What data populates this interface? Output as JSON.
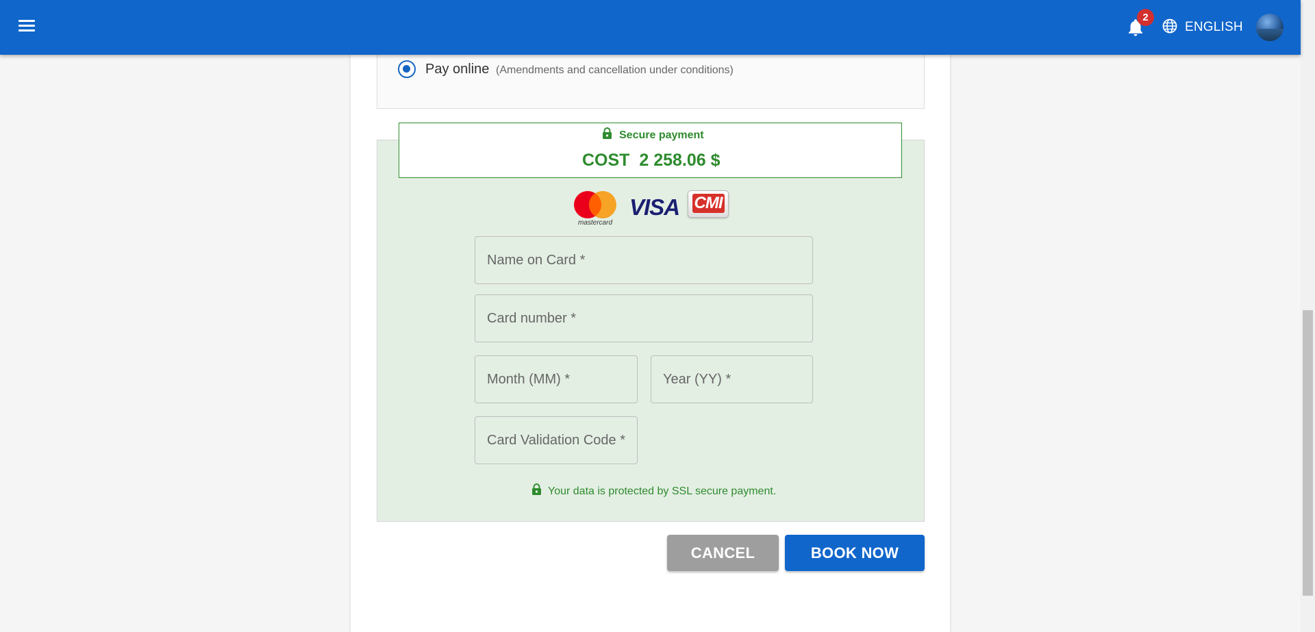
{
  "header": {
    "notification_count": "2",
    "language": "ENGLISH",
    "bar_color": "#1066cb",
    "icons": [
      "menu-icon",
      "bell-icon",
      "globe-icon",
      "avatar"
    ]
  },
  "payment_option": {
    "label": "Pay online",
    "note": "(Amendments and cancellation under conditions)",
    "selected": true
  },
  "secure": {
    "label": "Secure payment",
    "cost_label": "COST",
    "cost_value": "2 258.06 $",
    "accent_color": "#2e8b2e"
  },
  "card_logos": {
    "mastercard": "mastercard",
    "visa": "VISA",
    "cmi": "CMI"
  },
  "form": {
    "name_placeholder": "Name on Card *",
    "card_number_placeholder": "Card number *",
    "month_placeholder": "Month (MM) *",
    "year_placeholder": "Year (YY) *",
    "cvc_placeholder": "Card Validation Code *"
  },
  "ssl_note": "Your data is protected by SSL secure payment.",
  "actions": {
    "cancel_label": "CANCEL",
    "book_label": "BOOK NOW"
  }
}
